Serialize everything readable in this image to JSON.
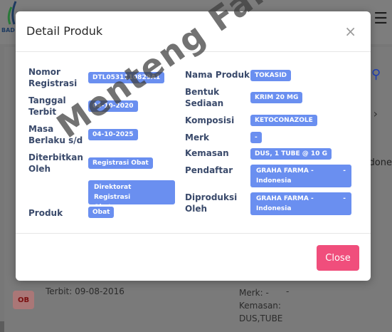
{
  "background": {
    "logo_text": "BAD",
    "side_text": "done",
    "item_badge": "OB",
    "terbit": "Terbit: 09-08-2016",
    "merk_lines": [
      "Merk: -",
      "Kemasan:",
      "DUS,TUBE"
    ],
    "merk_dash": "-"
  },
  "modal": {
    "title": "Detail Produk",
    "close_icon": "×",
    "close_button": "Close"
  },
  "left": [
    {
      "label": [
        "Nomor",
        "Registrasi"
      ],
      "value": "DTL0531110829A1"
    },
    {
      "label": [
        "Tanggal",
        "Terbit"
      ],
      "value": "04-10-2020"
    },
    {
      "label": [
        "Masa",
        "Berlaku s/d"
      ],
      "value": "04-10-2025"
    },
    {
      "label": [
        "Diterbitkan",
        "Oleh"
      ],
      "value": "Registrasi Obat"
    },
    {
      "label": [
        ""
      ],
      "value_lines": [
        "Direktorat Registrasi",
        "Obat"
      ]
    },
    {
      "label": [
        "Produk"
      ],
      "value": "Obat"
    }
  ],
  "right": [
    {
      "label": [
        "Nama Produk"
      ],
      "value": "TOKASID"
    },
    {
      "label": [
        "Bentuk",
        "Sediaan"
      ],
      "value": "KRIM 20 MG"
    },
    {
      "label": [
        "Komposisi"
      ],
      "value": "KETOCONAZOLE"
    },
    {
      "label": [
        "Merk"
      ],
      "value": "-"
    },
    {
      "label": [
        "Kemasan"
      ],
      "value": "DUS, 1 TUBE @ 10 G"
    },
    {
      "label": [
        "Pendaftar"
      ],
      "value_lines": [
        "GRAHA FARMA -",
        "Indonesia"
      ],
      "dash": "-"
    },
    {
      "label": [
        "Diproduksi",
        "Oleh"
      ],
      "value_lines": [
        "GRAHA FARMA -",
        "Indonesia"
      ],
      "dash": "-"
    }
  ],
  "watermark": "Menteng Farma",
  "colors": {
    "badge": "#6a8ff0",
    "close_button": "#f04e7c",
    "label": "#3a4a6b"
  }
}
